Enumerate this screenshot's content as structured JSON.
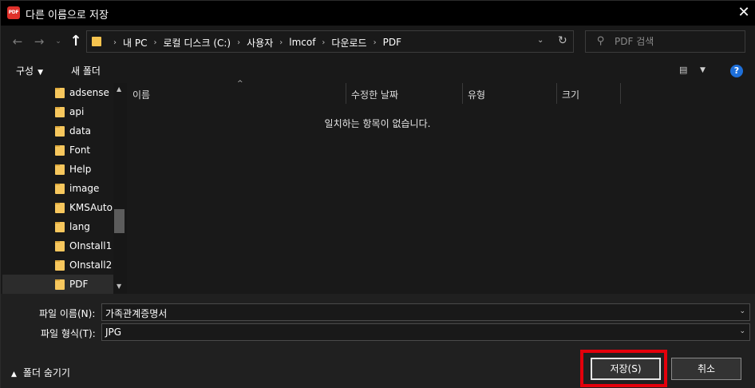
{
  "window": {
    "app_icon_text": "PDF",
    "title": "다른 이름으로 저장",
    "close_glyph": "✕"
  },
  "nav": {
    "back_icon": "arrow-left-icon",
    "forward_icon": "arrow-right-icon",
    "recent_icon": "chevron-down-icon",
    "up_icon": "arrow-up-icon",
    "breadcrumbs": [
      "내 PC",
      "로컬 디스크 (C:)",
      "사용자",
      "lmcof",
      "다운로드",
      "PDF"
    ],
    "refresh_icon": "refresh-icon"
  },
  "search": {
    "placeholder": "PDF 검색"
  },
  "toolbar": {
    "organize_label": "구성",
    "new_folder_label": "새 폴더",
    "help_label": "?"
  },
  "sidebar": {
    "items": [
      {
        "label": "adsense"
      },
      {
        "label": "api"
      },
      {
        "label": "data"
      },
      {
        "label": "Font"
      },
      {
        "label": "Help"
      },
      {
        "label": "image"
      },
      {
        "label": "KMSAuto"
      },
      {
        "label": "lang"
      },
      {
        "label": "OInstall1"
      },
      {
        "label": "OInstall2"
      },
      {
        "label": "PDF",
        "selected": true
      }
    ]
  },
  "list": {
    "columns": [
      "이름",
      "수정한 날짜",
      "유형",
      "크기"
    ],
    "empty_message": "일치하는 항목이 없습니다."
  },
  "form": {
    "filename_label": "파일 이름(N):",
    "filename_value": "가족관계증명서",
    "filetype_label": "파일 형식(T):",
    "filetype_value": "JPG",
    "hide_folders_label": "폴더 숨기기",
    "save_label": "저장(S)",
    "cancel_label": "취소"
  },
  "colors": {
    "background": "#191919",
    "titlebar": "#000000",
    "highlight": "#e4000b",
    "folder": "#f7c75d",
    "help": "#1e6fd9"
  }
}
